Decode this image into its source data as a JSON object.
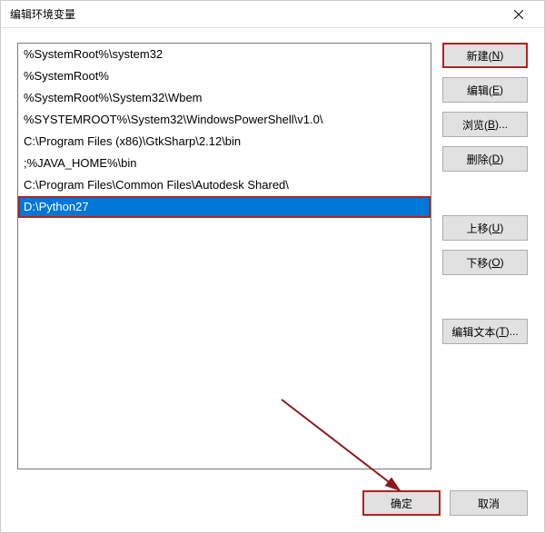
{
  "dialog": {
    "title": "编辑环境变量"
  },
  "paths": [
    "%SystemRoot%\\system32",
    "%SystemRoot%",
    "%SystemRoot%\\System32\\Wbem",
    "%SYSTEMROOT%\\System32\\WindowsPowerShell\\v1.0\\",
    "C:\\Program Files (x86)\\GtkSharp\\2.12\\bin",
    ";%JAVA_HOME%\\bin",
    "C:\\Program Files\\Common Files\\Autodesk Shared\\",
    "D:\\Python27"
  ],
  "selected_index": 7,
  "highlighted_item_index": 7,
  "buttons": {
    "new": {
      "label": "新建(",
      "accel": "N",
      "suffix": ")"
    },
    "edit": {
      "label": "编辑(",
      "accel": "E",
      "suffix": ")"
    },
    "browse": {
      "label": "浏览(",
      "accel": "B",
      "suffix": ")..."
    },
    "delete": {
      "label": "删除(",
      "accel": "D",
      "suffix": ")"
    },
    "moveup": {
      "label": "上移(",
      "accel": "U",
      "suffix": ")"
    },
    "movedown": {
      "label": "下移(",
      "accel": "O",
      "suffix": ")"
    },
    "edittext": {
      "label": "编辑文本(",
      "accel": "T",
      "suffix": ")..."
    },
    "ok": {
      "label": "确定"
    },
    "cancel": {
      "label": "取消"
    }
  }
}
